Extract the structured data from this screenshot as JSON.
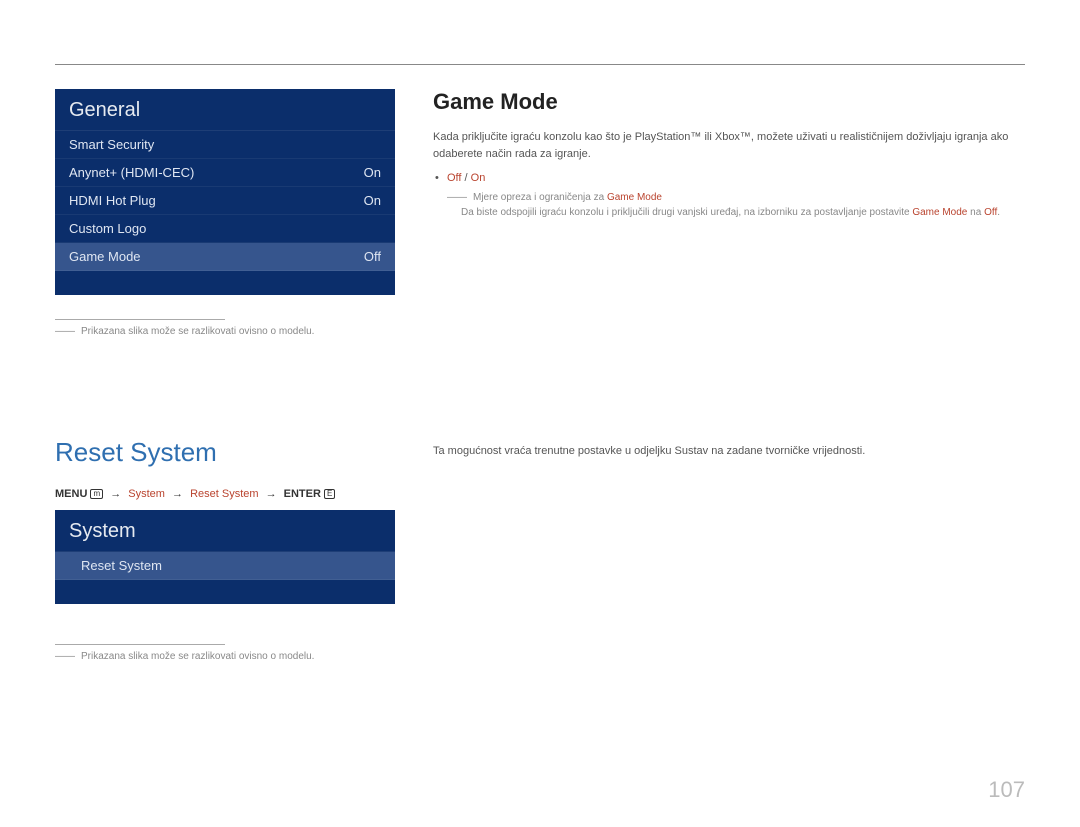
{
  "page_number": "107",
  "general_menu": {
    "title": "General",
    "rows": [
      {
        "label": "Smart Security",
        "value": ""
      },
      {
        "label": "Anynet+ (HDMI-CEC)",
        "value": "On"
      },
      {
        "label": "HDMI Hot Plug",
        "value": "On"
      },
      {
        "label": "Custom Logo",
        "value": ""
      },
      {
        "label": "Game Mode",
        "value": "Off"
      }
    ],
    "footnote_dash": "――",
    "footnote": "Prikazana slika može se razlikovati ovisno o modelu."
  },
  "game_mode": {
    "heading": "Game Mode",
    "desc": "Kada priključite igraću konzolu kao što je PlayStation™ ili Xbox™, možete uživati u realističnijem doživljaju igranja ako odaberete način rada za igranje.",
    "opt_off": "Off",
    "opt_sep": " / ",
    "opt_on": "On",
    "note_dash": "――",
    "note1_pre": "Mjere opreza i ograničenja za ",
    "note1_term": "Game Mode",
    "note2_pre": "Da biste odspojili igraću konzolu i priključili drugi vanjski uređaj, na izborniku za postavljanje postavite ",
    "note2_mid": "Game Mode",
    "note2_mid2": " na ",
    "note2_end": "Off",
    "note2_dot": "."
  },
  "reset": {
    "heading": "Reset System",
    "bc_menu": "MENU",
    "bc_icon": "m",
    "bc_sys": "System",
    "bc_reset": "Reset System",
    "bc_enter": "ENTER",
    "bc_enter_icon": "E",
    "arrow": "→",
    "menu_title": "System",
    "menu_item": "Reset System",
    "footnote_dash": "――",
    "footnote": "Prikazana slika može se razlikovati ovisno o modelu.",
    "right_text": "Ta mogućnost vraća trenutne postavke u odjeljku Sustav na zadane tvorničke vrijednosti."
  }
}
